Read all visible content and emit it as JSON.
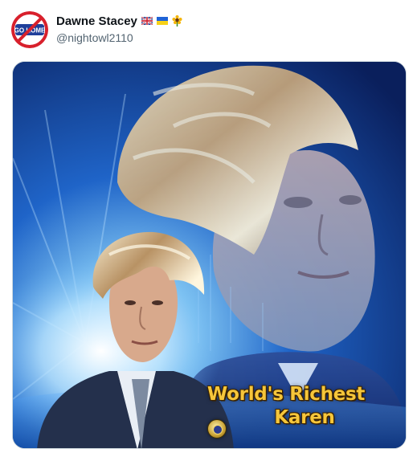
{
  "post": {
    "author": {
      "display_name": "Dawne Stacey",
      "handle": "@nightowl2110",
      "badges": [
        "uk-flag-icon",
        "ukraine-flag-icon",
        "sunflower-icon"
      ],
      "avatar_text": "GO HOME"
    },
    "media": {
      "caption_line1": "World's Richest",
      "caption_line2": "Karen"
    }
  },
  "colors": {
    "caption": "#f6c63a",
    "handle": "#536471",
    "name": "#0f1419",
    "avatar_ring": "#d8202c",
    "avatar_badge": "#1f3f9a"
  }
}
